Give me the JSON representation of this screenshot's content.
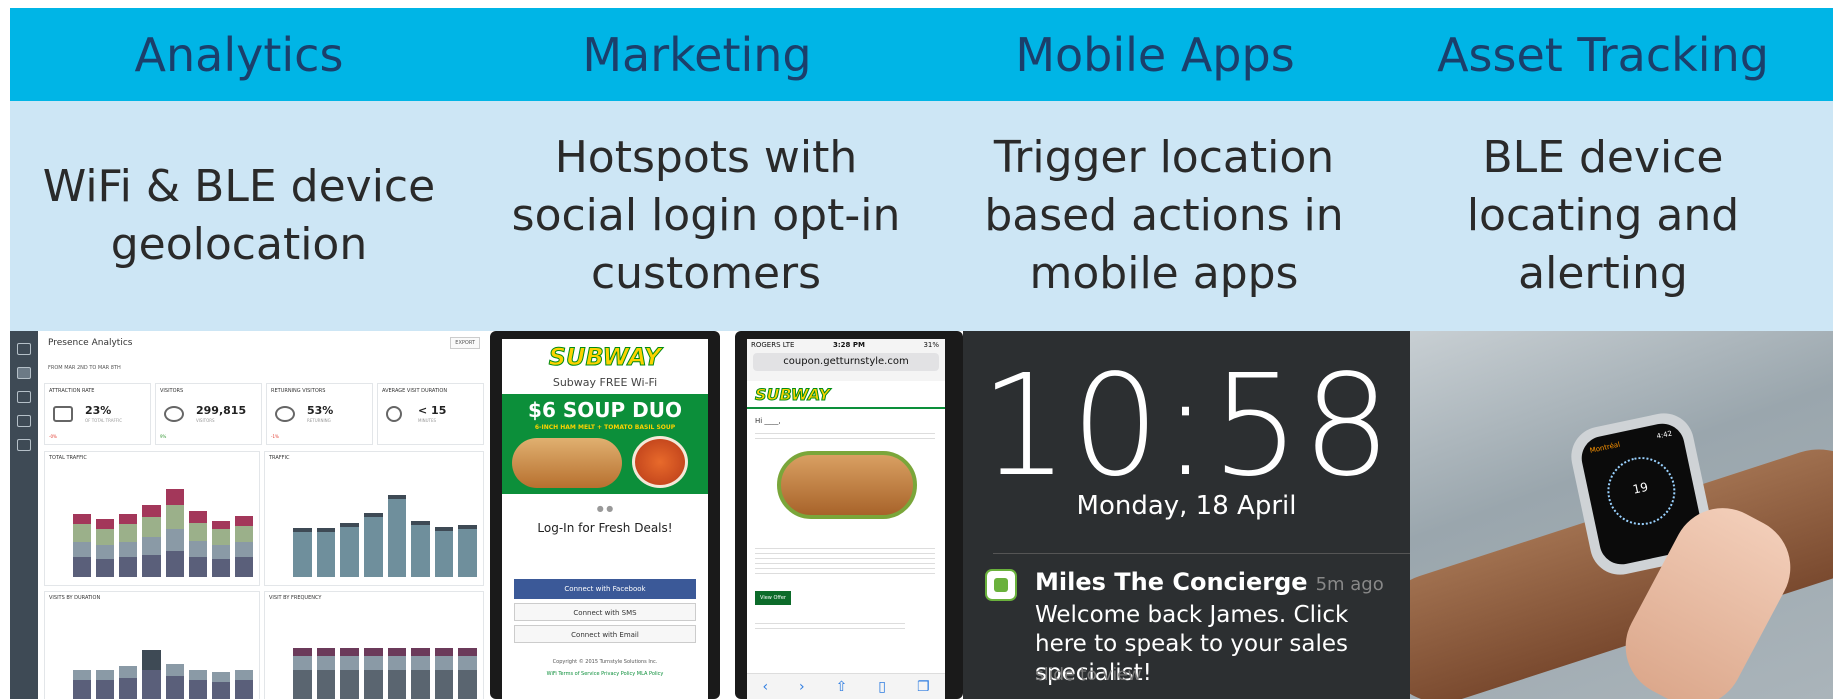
{
  "columns": [
    {
      "title": "Analytics",
      "description": "WiFi & BLE device geolocation"
    },
    {
      "title": "Marketing",
      "description": "Hotspots with social login opt-in customers"
    },
    {
      "title": "Mobile Apps",
      "description": "Trigger location based actions in mobile apps"
    },
    {
      "title": "Asset Tracking",
      "description": "BLE device locating and alerting"
    }
  ],
  "colors": {
    "header": "#00b5e6",
    "header_text": "#1b3f6b",
    "band": "#cde6f5",
    "band_text": "#2a2a2a"
  },
  "dashboard": {
    "title": "Presence Analytics",
    "export_label": "EXPORT",
    "date_range": "FROM MAR 2ND TO MAR 8TH",
    "tiles": [
      {
        "label": "ATTRACTION RATE",
        "value": "23%",
        "sub": "OF TOTAL TRAFFIC",
        "change": "-0%"
      },
      {
        "label": "VISITORS",
        "value": "299,815",
        "sub": "VISITORS",
        "change": "9%"
      },
      {
        "label": "RETURNING VISITORS",
        "value": "53%",
        "sub": "RETURNING",
        "change": "-1%"
      },
      {
        "label": "AVERAGE VISIT DURATION",
        "value": "< 15",
        "sub": "MINUTES",
        "change": ""
      }
    ],
    "panels": [
      "TOTAL TRAFFIC",
      "TRAFFIC",
      "VISITS BY DURATION",
      "VISIT BY FREQUENCY"
    ]
  },
  "phone1": {
    "brand": "SUBWAY",
    "wifi_title": "Subway FREE Wi-Fi",
    "promo_price": "$6",
    "promo_name": "SOUP DUO",
    "promo_sub": "6-INCH HAM MELT + TOMATO BASIL SOUP",
    "login_title": "Log-In for Fresh Deals!",
    "fb_button": "Connect with Facebook",
    "sms_button": "Connect with SMS",
    "email_button": "Connect with Email",
    "copyright": "Copyright © 2015 Turnstyle Solutions Inc.",
    "links": "WiFi Terms of Service   Privacy Policy   MLA Policy"
  },
  "phone2": {
    "carrier": "ROGERS  LTE",
    "time": "3:28 PM",
    "battery": "31%",
    "url": "coupon.getturnstyle.com",
    "brand": "SUBWAY",
    "greeting": "Hi ____,",
    "offer_button": "View Offer"
  },
  "lockscreen": {
    "time": "10:58",
    "date": "Monday, 18 April",
    "notif_title": "Miles The Concierge",
    "notif_age": "5m ago",
    "notif_body": "Welcome back James. Click here to speak to your sales specialist!",
    "slide_hint": "slide to view"
  },
  "watch": {
    "label": "Montréal",
    "time": "4:42",
    "day": "19"
  }
}
